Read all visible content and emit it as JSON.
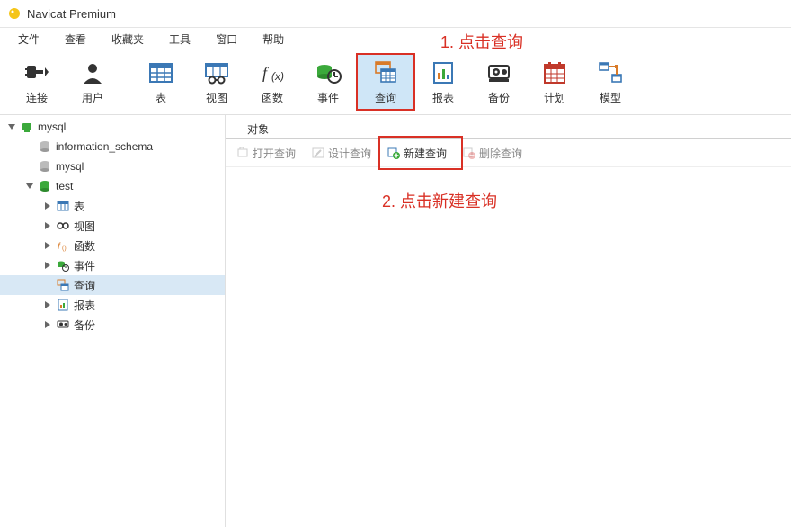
{
  "title": "Navicat Premium",
  "menu": [
    "文件",
    "查看",
    "收藏夹",
    "工具",
    "窗口",
    "帮助"
  ],
  "toolbar": [
    {
      "label": "连接",
      "icon": "plug"
    },
    {
      "label": "用户",
      "icon": "user"
    },
    {
      "label": "表",
      "icon": "table"
    },
    {
      "label": "视图",
      "icon": "view"
    },
    {
      "label": "函数",
      "icon": "function"
    },
    {
      "label": "事件",
      "icon": "event"
    },
    {
      "label": "查询",
      "icon": "query",
      "selected": true
    },
    {
      "label": "报表",
      "icon": "report"
    },
    {
      "label": "备份",
      "icon": "backup"
    },
    {
      "label": "计划",
      "icon": "schedule"
    },
    {
      "label": "模型",
      "icon": "model"
    }
  ],
  "annotation1": "1. 点击查询",
  "annotation2": "2. 点击新建查询",
  "sidebar": {
    "items": [
      {
        "indent": 0,
        "expander": "open",
        "icon": "conn-green",
        "label": "mysql"
      },
      {
        "indent": 1,
        "expander": "none",
        "icon": "db-gray",
        "label": "information_schema"
      },
      {
        "indent": 1,
        "expander": "none",
        "icon": "db-gray",
        "label": "mysql"
      },
      {
        "indent": 1,
        "expander": "open",
        "icon": "db-green",
        "label": "test"
      },
      {
        "indent": 2,
        "expander": "closed",
        "icon": "table",
        "label": "表"
      },
      {
        "indent": 2,
        "expander": "closed",
        "icon": "view",
        "label": "视图"
      },
      {
        "indent": 2,
        "expander": "closed",
        "icon": "function",
        "label": "函数"
      },
      {
        "indent": 2,
        "expander": "closed",
        "icon": "event",
        "label": "事件"
      },
      {
        "indent": 2,
        "expander": "none",
        "icon": "query",
        "label": "查询",
        "selected": true
      },
      {
        "indent": 2,
        "expander": "closed",
        "icon": "report",
        "label": "报表"
      },
      {
        "indent": 2,
        "expander": "closed",
        "icon": "backup",
        "label": "备份"
      }
    ]
  },
  "tab": "对象",
  "subtoolbar": [
    {
      "label": "打开查询",
      "icon": "open",
      "active": false
    },
    {
      "label": "设计查询",
      "icon": "design",
      "active": false
    },
    {
      "label": "新建查询",
      "icon": "new",
      "active": true
    },
    {
      "label": "删除查询",
      "icon": "delete",
      "active": false
    }
  ]
}
